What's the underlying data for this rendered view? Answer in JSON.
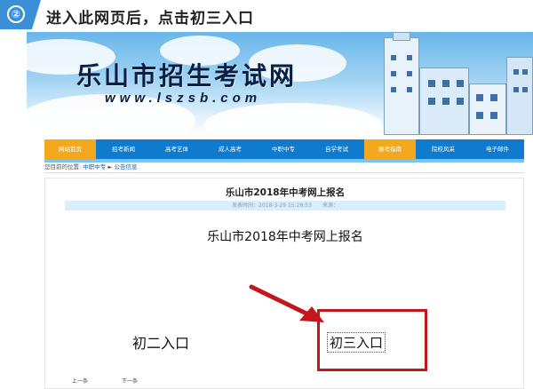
{
  "step": {
    "number": "②",
    "instruction": "进入此网页后，点击初三入口"
  },
  "site": {
    "title": "乐山市招生考试网",
    "url": "www.lszsb.com"
  },
  "nav": {
    "items": [
      "网站首页",
      "招考新闻",
      "高考艺体",
      "成人高考",
      "中职中专",
      "自学考试",
      "报考指南",
      "院校风采",
      "电子邮件"
    ],
    "active_index": 0,
    "highlight_index": 6
  },
  "breadcrumb": {
    "prefix": "您目前的位置:",
    "items": [
      "中职中专",
      "公告信息"
    ],
    "separator": "►"
  },
  "article": {
    "title": "乐山市2018年中考网上报名",
    "meta": "发表时间：2018-3-29 15:28:53　　来源：",
    "heading": "乐山市2018年中考网上报名",
    "entry_grade2": "初二入口",
    "entry_grade3": "初三入口",
    "prev": "上一条",
    "next": "下一条"
  },
  "colors": {
    "accent": "#3a8fd6",
    "nav": "#0f7bcf",
    "nav_active": "#f4a81d",
    "highlight": "#c4161c"
  }
}
